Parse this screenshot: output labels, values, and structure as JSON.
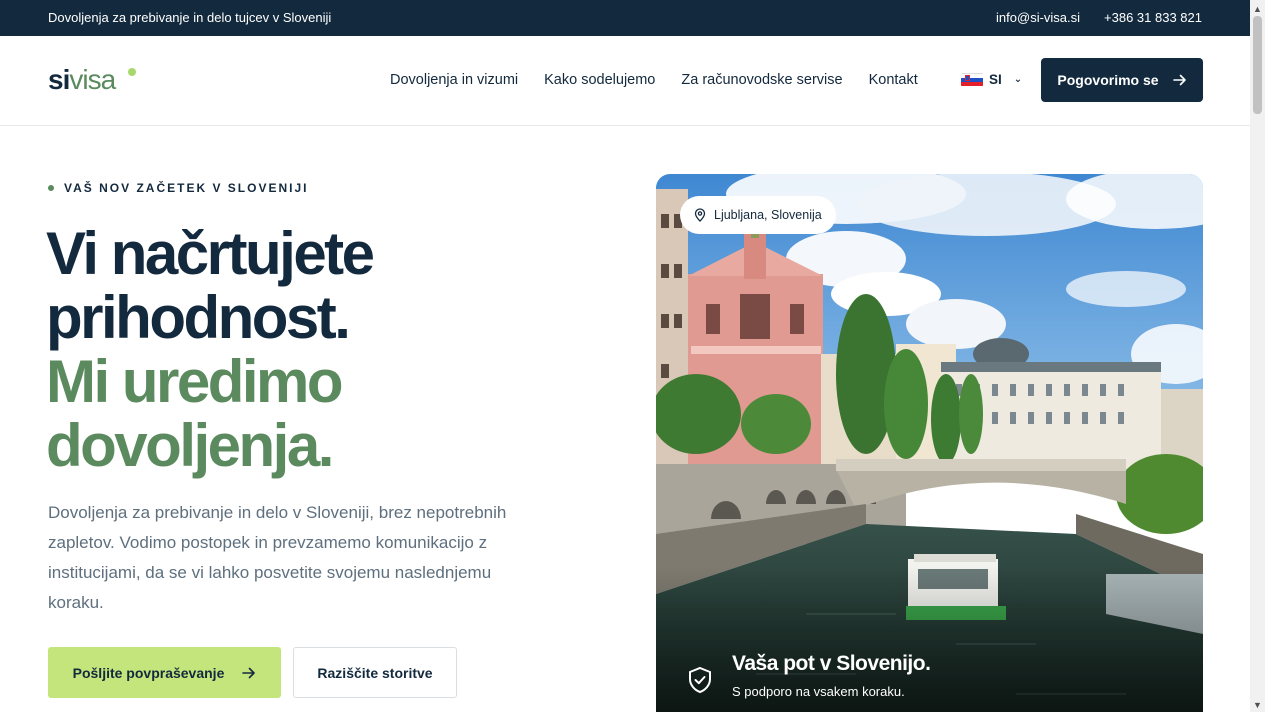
{
  "topbar": {
    "tagline": "Dovoljenja za prebivanje in delo tujcev v Sloveniji",
    "email": "info@si-visa.si",
    "phone": "+386 31 833 821"
  },
  "header": {
    "logo_si": "si",
    "logo_visa": "visa",
    "nav": [
      "Dovoljenja in vizumi",
      "Kako sodelujemo",
      "Za računovodske servise",
      "Kontakt"
    ],
    "language": "SI",
    "cta_label": "Pogovorimo se"
  },
  "hero": {
    "eyebrow": "VAŠ NOV ZAČETEK V SLOVENIJI",
    "headline_dark": [
      "Vi načrtujete",
      "prihodnost."
    ],
    "headline_green": [
      "Mi uredimo",
      "dovoljenja."
    ],
    "lead": "Dovoljenja za prebivanje in delo v Sloveniji, brez nepotrebnih zapletov. Vodimo postopek in prevzamemo komunikacijo z institucijami, da se vi lahko posvetite svojemu naslednjemu koraku.",
    "primary_button": "Pošljite povpraševanje",
    "secondary_button": "Raziščite storitve",
    "image": {
      "location": "Ljubljana, Slovenija",
      "caption_title": "Vaša pot v Slovenijo.",
      "caption_subtitle": "S podporo na vsakem koraku."
    }
  },
  "colors": {
    "navy": "#132a3e",
    "green": "#5b8a5e",
    "lime": "#c4e57c"
  }
}
